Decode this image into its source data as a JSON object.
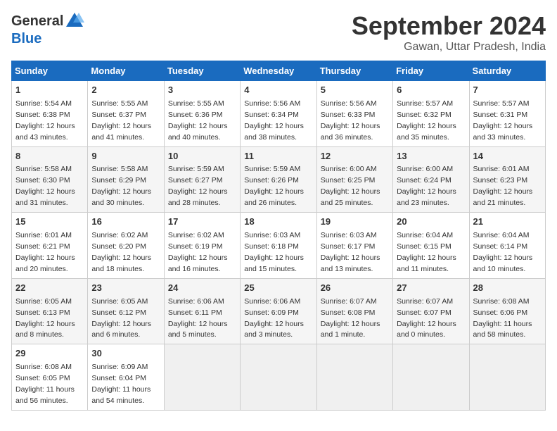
{
  "header": {
    "logo_general": "General",
    "logo_blue": "Blue",
    "month_title": "September 2024",
    "location": "Gawan, Uttar Pradesh, India"
  },
  "days_of_week": [
    "Sunday",
    "Monday",
    "Tuesday",
    "Wednesday",
    "Thursday",
    "Friday",
    "Saturday"
  ],
  "weeks": [
    [
      {
        "day": "1",
        "info": "Sunrise: 5:54 AM\nSunset: 6:38 PM\nDaylight: 12 hours\nand 43 minutes."
      },
      {
        "day": "2",
        "info": "Sunrise: 5:55 AM\nSunset: 6:37 PM\nDaylight: 12 hours\nand 41 minutes."
      },
      {
        "day": "3",
        "info": "Sunrise: 5:55 AM\nSunset: 6:36 PM\nDaylight: 12 hours\nand 40 minutes."
      },
      {
        "day": "4",
        "info": "Sunrise: 5:56 AM\nSunset: 6:34 PM\nDaylight: 12 hours\nand 38 minutes."
      },
      {
        "day": "5",
        "info": "Sunrise: 5:56 AM\nSunset: 6:33 PM\nDaylight: 12 hours\nand 36 minutes."
      },
      {
        "day": "6",
        "info": "Sunrise: 5:57 AM\nSunset: 6:32 PM\nDaylight: 12 hours\nand 35 minutes."
      },
      {
        "day": "7",
        "info": "Sunrise: 5:57 AM\nSunset: 6:31 PM\nDaylight: 12 hours\nand 33 minutes."
      }
    ],
    [
      {
        "day": "8",
        "info": "Sunrise: 5:58 AM\nSunset: 6:30 PM\nDaylight: 12 hours\nand 31 minutes."
      },
      {
        "day": "9",
        "info": "Sunrise: 5:58 AM\nSunset: 6:29 PM\nDaylight: 12 hours\nand 30 minutes."
      },
      {
        "day": "10",
        "info": "Sunrise: 5:59 AM\nSunset: 6:27 PM\nDaylight: 12 hours\nand 28 minutes."
      },
      {
        "day": "11",
        "info": "Sunrise: 5:59 AM\nSunset: 6:26 PM\nDaylight: 12 hours\nand 26 minutes."
      },
      {
        "day": "12",
        "info": "Sunrise: 6:00 AM\nSunset: 6:25 PM\nDaylight: 12 hours\nand 25 minutes."
      },
      {
        "day": "13",
        "info": "Sunrise: 6:00 AM\nSunset: 6:24 PM\nDaylight: 12 hours\nand 23 minutes."
      },
      {
        "day": "14",
        "info": "Sunrise: 6:01 AM\nSunset: 6:23 PM\nDaylight: 12 hours\nand 21 minutes."
      }
    ],
    [
      {
        "day": "15",
        "info": "Sunrise: 6:01 AM\nSunset: 6:21 PM\nDaylight: 12 hours\nand 20 minutes."
      },
      {
        "day": "16",
        "info": "Sunrise: 6:02 AM\nSunset: 6:20 PM\nDaylight: 12 hours\nand 18 minutes."
      },
      {
        "day": "17",
        "info": "Sunrise: 6:02 AM\nSunset: 6:19 PM\nDaylight: 12 hours\nand 16 minutes."
      },
      {
        "day": "18",
        "info": "Sunrise: 6:03 AM\nSunset: 6:18 PM\nDaylight: 12 hours\nand 15 minutes."
      },
      {
        "day": "19",
        "info": "Sunrise: 6:03 AM\nSunset: 6:17 PM\nDaylight: 12 hours\nand 13 minutes."
      },
      {
        "day": "20",
        "info": "Sunrise: 6:04 AM\nSunset: 6:15 PM\nDaylight: 12 hours\nand 11 minutes."
      },
      {
        "day": "21",
        "info": "Sunrise: 6:04 AM\nSunset: 6:14 PM\nDaylight: 12 hours\nand 10 minutes."
      }
    ],
    [
      {
        "day": "22",
        "info": "Sunrise: 6:05 AM\nSunset: 6:13 PM\nDaylight: 12 hours\nand 8 minutes."
      },
      {
        "day": "23",
        "info": "Sunrise: 6:05 AM\nSunset: 6:12 PM\nDaylight: 12 hours\nand 6 minutes."
      },
      {
        "day": "24",
        "info": "Sunrise: 6:06 AM\nSunset: 6:11 PM\nDaylight: 12 hours\nand 5 minutes."
      },
      {
        "day": "25",
        "info": "Sunrise: 6:06 AM\nSunset: 6:09 PM\nDaylight: 12 hours\nand 3 minutes."
      },
      {
        "day": "26",
        "info": "Sunrise: 6:07 AM\nSunset: 6:08 PM\nDaylight: 12 hours\nand 1 minute."
      },
      {
        "day": "27",
        "info": "Sunrise: 6:07 AM\nSunset: 6:07 PM\nDaylight: 12 hours\nand 0 minutes."
      },
      {
        "day": "28",
        "info": "Sunrise: 6:08 AM\nSunset: 6:06 PM\nDaylight: 11 hours\nand 58 minutes."
      }
    ],
    [
      {
        "day": "29",
        "info": "Sunrise: 6:08 AM\nSunset: 6:05 PM\nDaylight: 11 hours\nand 56 minutes."
      },
      {
        "day": "30",
        "info": "Sunrise: 6:09 AM\nSunset: 6:04 PM\nDaylight: 11 hours\nand 54 minutes."
      },
      null,
      null,
      null,
      null,
      null
    ]
  ]
}
